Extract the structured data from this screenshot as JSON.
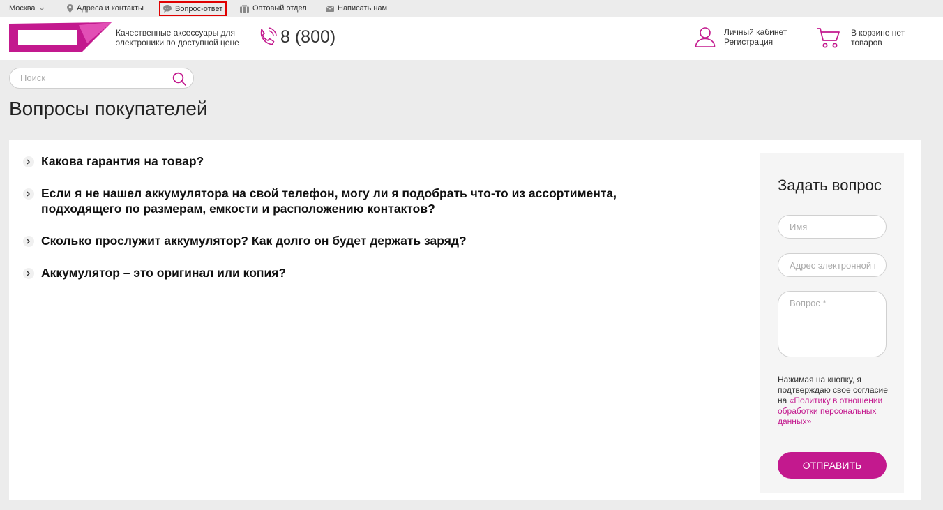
{
  "topbar": {
    "city": "Москва",
    "addresses": "Адреса и контакты",
    "faq": "Вопрос-ответ",
    "wholesale": "Оптовый отдел",
    "write": "Написать нам"
  },
  "header": {
    "tagline": "Качественные аксессуары для электроники по доступной цене",
    "phone": "8 (800)",
    "account_login": "Личный кабинет",
    "account_register": "Регистрация",
    "cart_status": "В корзине нет товаров"
  },
  "search": {
    "placeholder": "Поиск"
  },
  "page_title": "Вопросы покупателей",
  "faq": [
    {
      "question": "Какова гарантия на товар?"
    },
    {
      "question": "Если я не нашел аккумулятора на свой телефон, могу ли я подобрать что-то из ассортимента, подходящего по размерам, емкости и расположению контактов?"
    },
    {
      "question": "Сколько прослужит аккумулятор? Как долго он будет держать заряд?"
    },
    {
      "question": "Аккумулятор – это оригинал или копия?"
    }
  ],
  "ask_form": {
    "title": "Задать вопрос",
    "name_placeholder": "Имя",
    "email_placeholder": "Адрес электронной почты",
    "question_placeholder": "Вопрос *",
    "consent_text": "Нажимая на кнопку, я подтверждаю свое согласие на ",
    "consent_link": "«Политику в отношении обработки персональных данных»",
    "submit_label": "ОТПРАВИТЬ"
  },
  "colors": {
    "accent": "#c3198e",
    "highlight_border": "#e00000",
    "background": "#ececec"
  }
}
